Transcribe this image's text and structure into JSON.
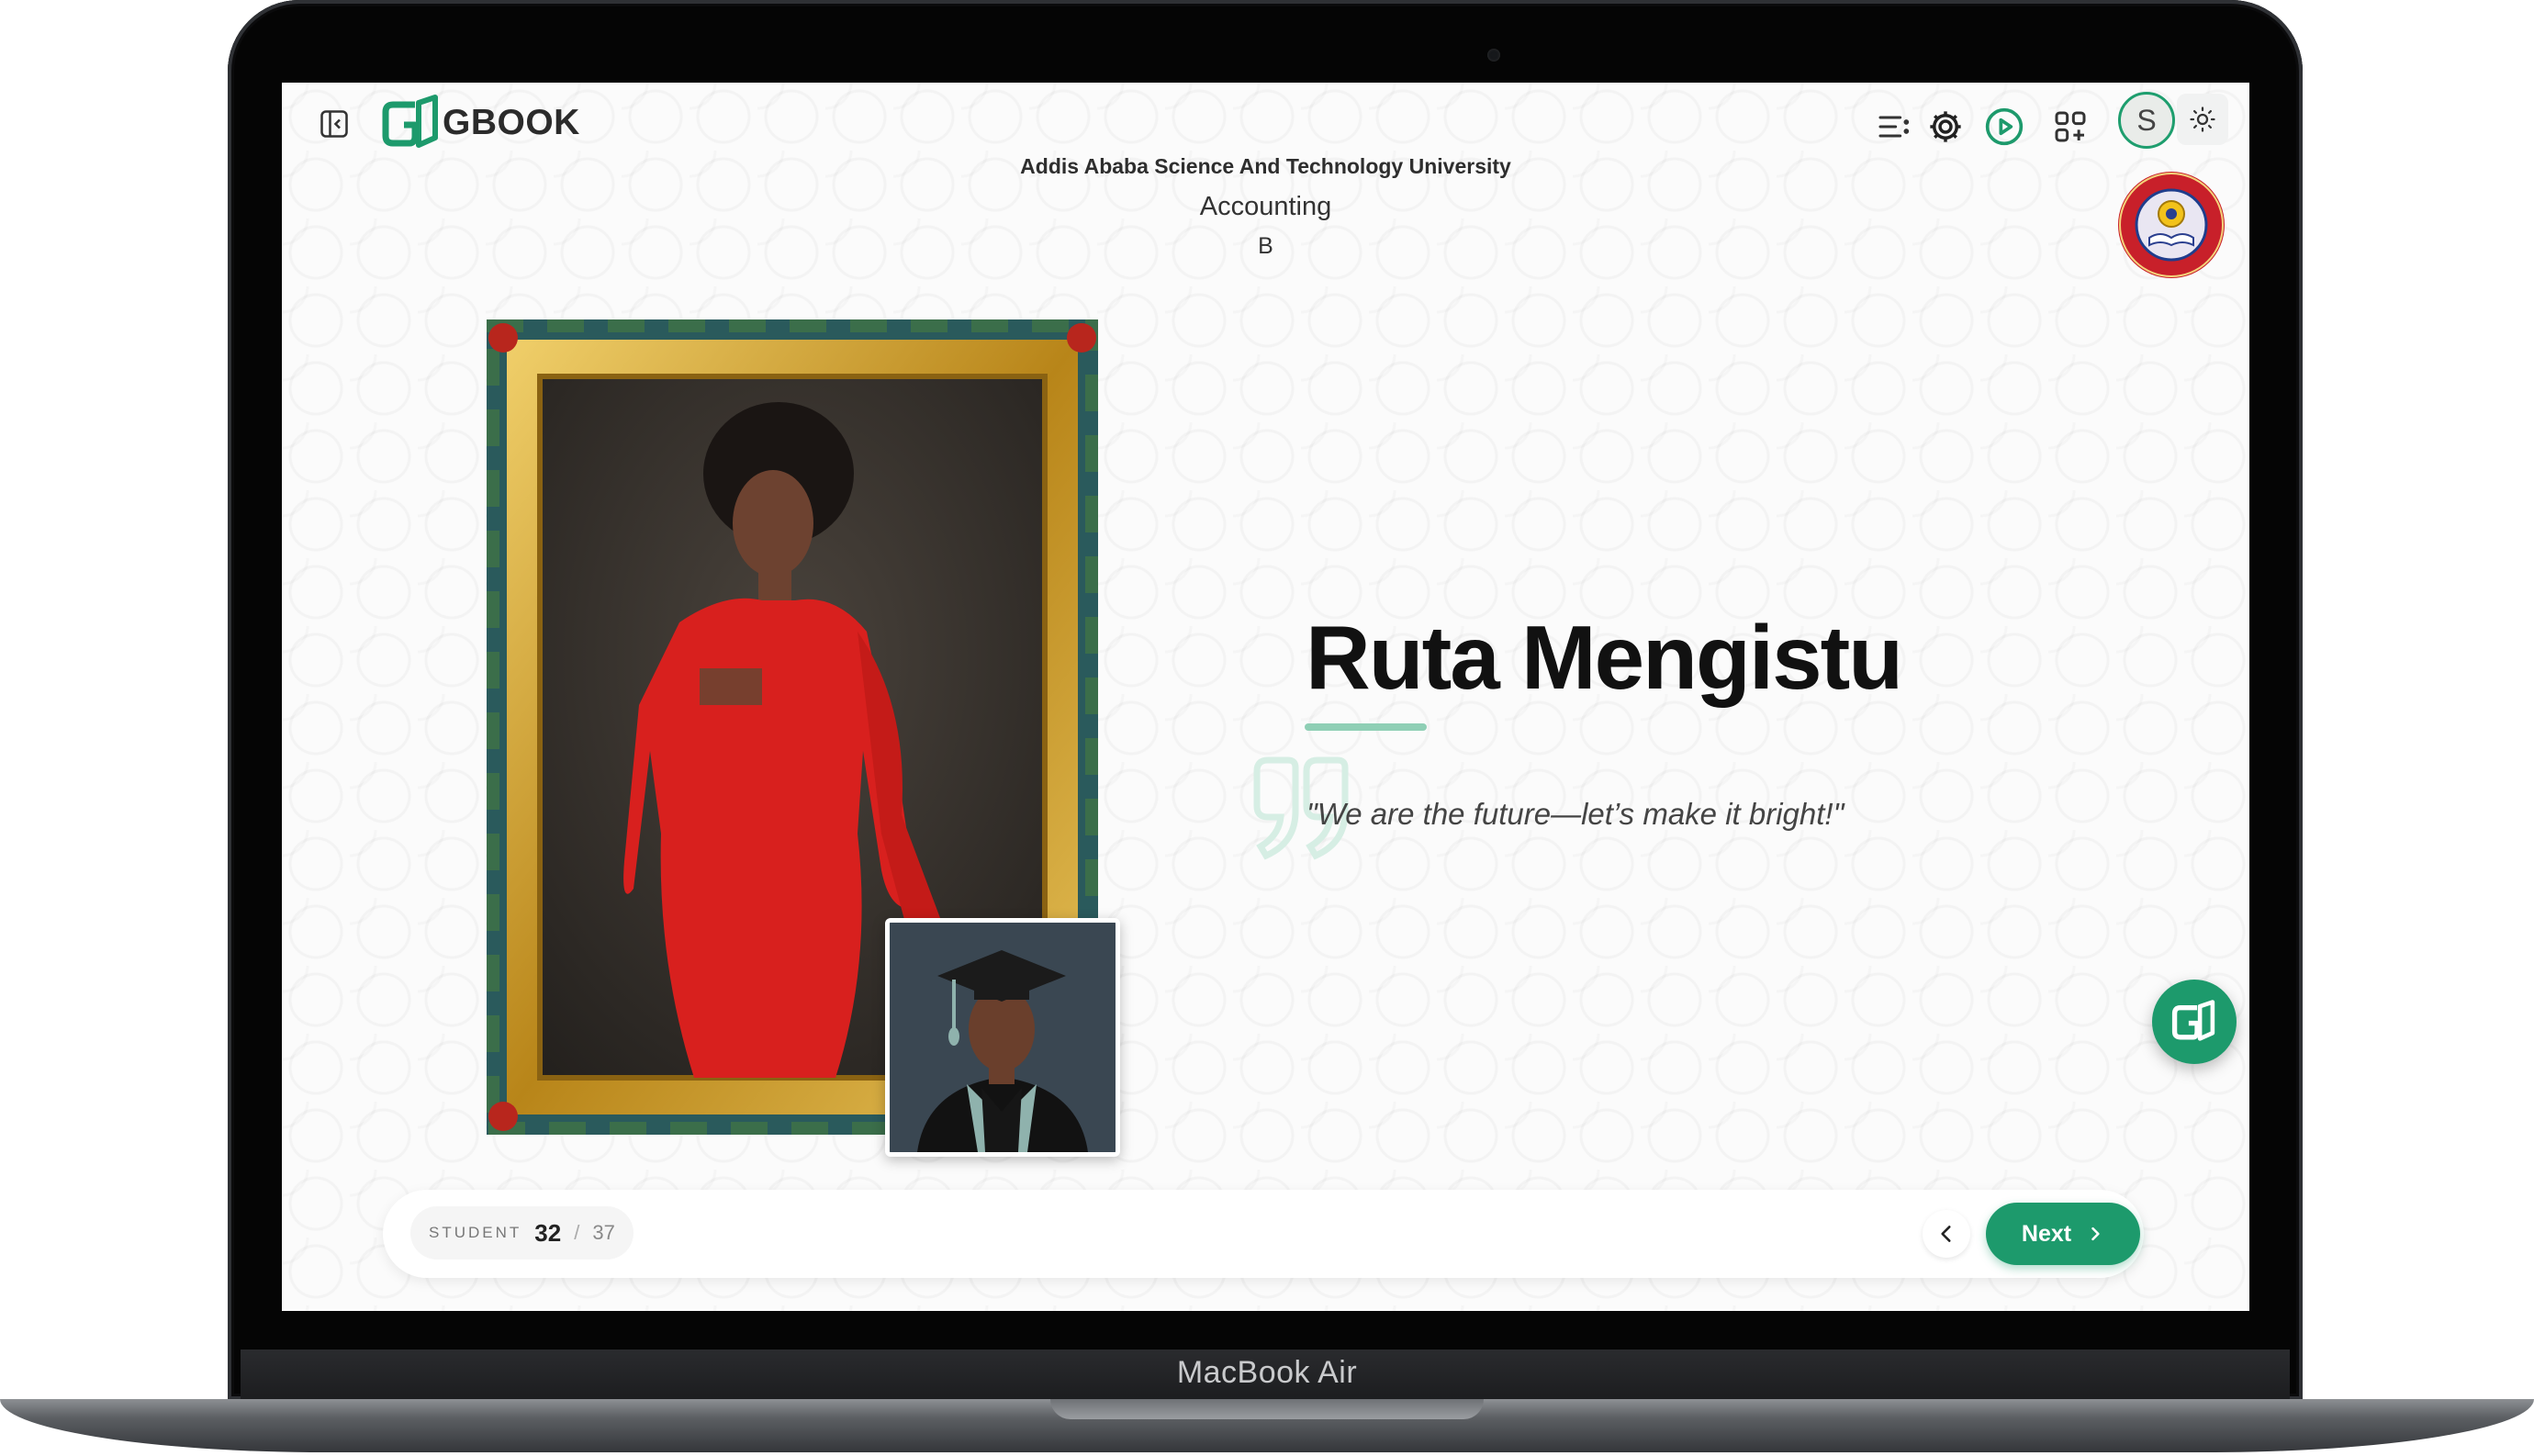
{
  "device": {
    "model_label": "MacBook Air"
  },
  "header": {
    "logo_text": "GBOOK",
    "avatar_initial": "S"
  },
  "context": {
    "university": "Addis Ababa Science And Technology University",
    "department": "Accounting",
    "section": "B"
  },
  "profile": {
    "name": "Ruta Mengistu",
    "quote": "\"We are the future—let’s make it bright!\""
  },
  "pagination": {
    "label": "STUDENT",
    "current": "32",
    "separator": "/",
    "total": "37",
    "next_label": "Next"
  },
  "colors": {
    "brand_green": "#1d9a6c",
    "underline_green": "#8fcfb5",
    "dress_red": "#d8201e",
    "frame_gold": "#c99a2e"
  },
  "icons": [
    "sidebar-toggle-icon",
    "list-filter-icon",
    "settings-icon",
    "play-icon",
    "apps-icon",
    "sun-icon",
    "chevron-left-icon",
    "chevron-right-icon",
    "quote-icon"
  ]
}
